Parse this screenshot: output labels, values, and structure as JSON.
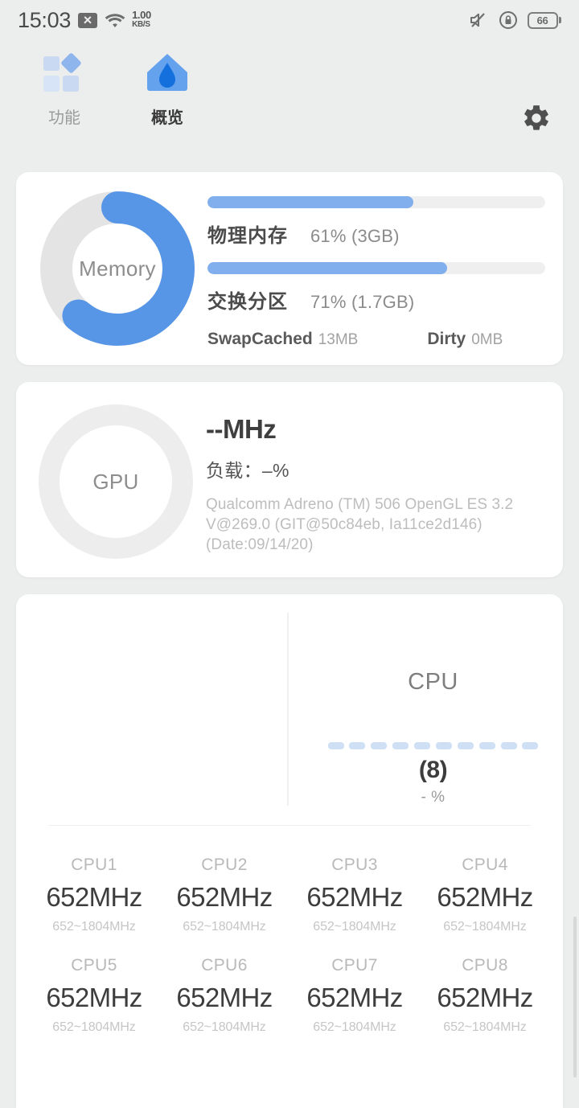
{
  "statusbar": {
    "clock": "15:03",
    "message_icon": "sms-disabled-icon",
    "wifi_icon": "wifi-icon",
    "net_rate_value": "1.00",
    "net_rate_unit": "KB/S",
    "mute_icon": "volume-mute-icon",
    "rotation_lock_icon": "rotation-lock-icon",
    "battery_level": "66"
  },
  "nav": {
    "tabs": [
      {
        "label": "功能",
        "icon": "grid-diamond-icon",
        "active": false
      },
      {
        "label": "概览",
        "icon": "home-icon",
        "active": true
      }
    ],
    "settings_icon": "gear-icon"
  },
  "memory": {
    "ring_label": "Memory",
    "ring_percent": 61,
    "rows": [
      {
        "name": "物理内存",
        "value": "61% (3GB)",
        "percent": 61
      },
      {
        "name": "交换分区",
        "value": "71% (1.7GB)",
        "percent": 71
      }
    ],
    "footer": [
      {
        "key": "SwapCached",
        "value": "13MB"
      },
      {
        "key": "Dirty",
        "value": "0MB"
      }
    ]
  },
  "gpu": {
    "ring_label": "GPU",
    "frequency": "--MHz",
    "load": "负载：–%",
    "description": "Qualcomm Adreno (TM) 506 OpenGL ES 3.2 V@269.0 (GIT@50c84eb, Ia11ce2d146) (Date:09/14/20)"
  },
  "cpu": {
    "title": "CPU",
    "core_count_label": "(8)",
    "usage": "- %",
    "dash_count": 10,
    "cores": [
      {
        "name": "CPU1",
        "freq": "652MHz",
        "range": "652~1804MHz"
      },
      {
        "name": "CPU2",
        "freq": "652MHz",
        "range": "652~1804MHz"
      },
      {
        "name": "CPU3",
        "freq": "652MHz",
        "range": "652~1804MHz"
      },
      {
        "name": "CPU4",
        "freq": "652MHz",
        "range": "652~1804MHz"
      },
      {
        "name": "CPU5",
        "freq": "652MHz",
        "range": "652~1804MHz"
      },
      {
        "name": "CPU6",
        "freq": "652MHz",
        "range": "652~1804MHz"
      },
      {
        "name": "CPU7",
        "freq": "652MHz",
        "range": "652~1804MHz"
      },
      {
        "name": "CPU8",
        "freq": "652MHz",
        "range": "652~1804MHz"
      }
    ]
  },
  "colors": {
    "accent": "#4a90e2",
    "bar_fill": "#81aeec",
    "page_bg": "#eceded",
    "card_bg": "#ffffff",
    "track": "#e6e6e6"
  }
}
